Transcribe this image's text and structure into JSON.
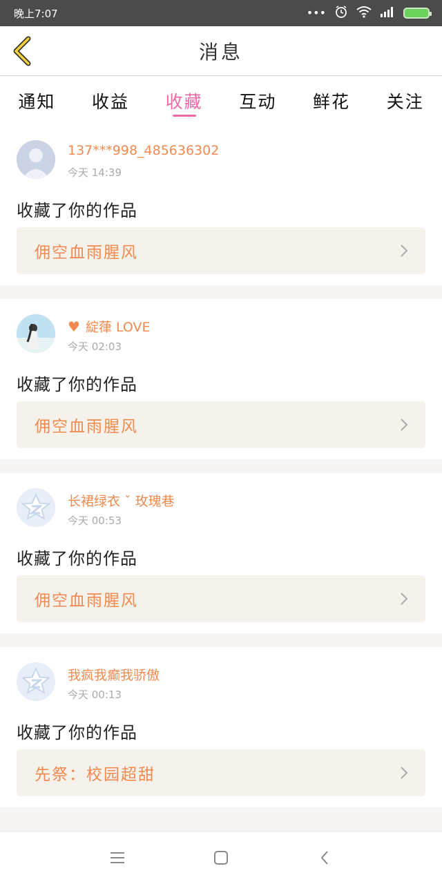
{
  "status_bar": {
    "time": "晚上7:07",
    "icons": [
      "more-dots-icon",
      "alarm-icon",
      "wifi-icon",
      "signal-icon",
      "battery-icon"
    ]
  },
  "header": {
    "title": "消息",
    "back_icon": "chevron-left-icon",
    "accent": "#f5d23b"
  },
  "tabs": [
    {
      "label": "通知",
      "active": false
    },
    {
      "label": "收益",
      "active": false
    },
    {
      "label": "收藏",
      "active": true
    },
    {
      "label": "互动",
      "active": false
    },
    {
      "label": "鲜花",
      "active": false
    },
    {
      "label": "关注",
      "active": false
    }
  ],
  "colors": {
    "accent_pink": "#ee6aa7",
    "username_orange": "#f08a50",
    "work_box_bg": "#f4f2ea"
  },
  "messages": [
    {
      "username": "137***998_485636302",
      "time": "今天 14:39",
      "action": "收藏了你的作品",
      "work": "佣空血雨腥风",
      "avatar": "default-avatar",
      "heart": false
    },
    {
      "username": "綻葎 LOVE",
      "time": "今天 02:03",
      "action": "收藏了你的作品",
      "work": "佣空血雨腥风",
      "avatar": "photo-avatar",
      "heart": true
    },
    {
      "username": "长裙绿衣 ˇ 玫瑰巷",
      "time": "今天 00:53",
      "action": "收藏了你的作品",
      "work": "佣空血雨腥风",
      "avatar": "qq-avatar",
      "heart": false
    },
    {
      "username": "我疯我癫我骄傲",
      "time": "今天 00:13",
      "action": "收藏了你的作品",
      "work": "先祭：校园超甜",
      "avatar": "qq-avatar",
      "heart": false
    }
  ],
  "nav_bar": {
    "icons": [
      "menu-icon",
      "home-square-icon",
      "back-triangle-icon"
    ]
  }
}
